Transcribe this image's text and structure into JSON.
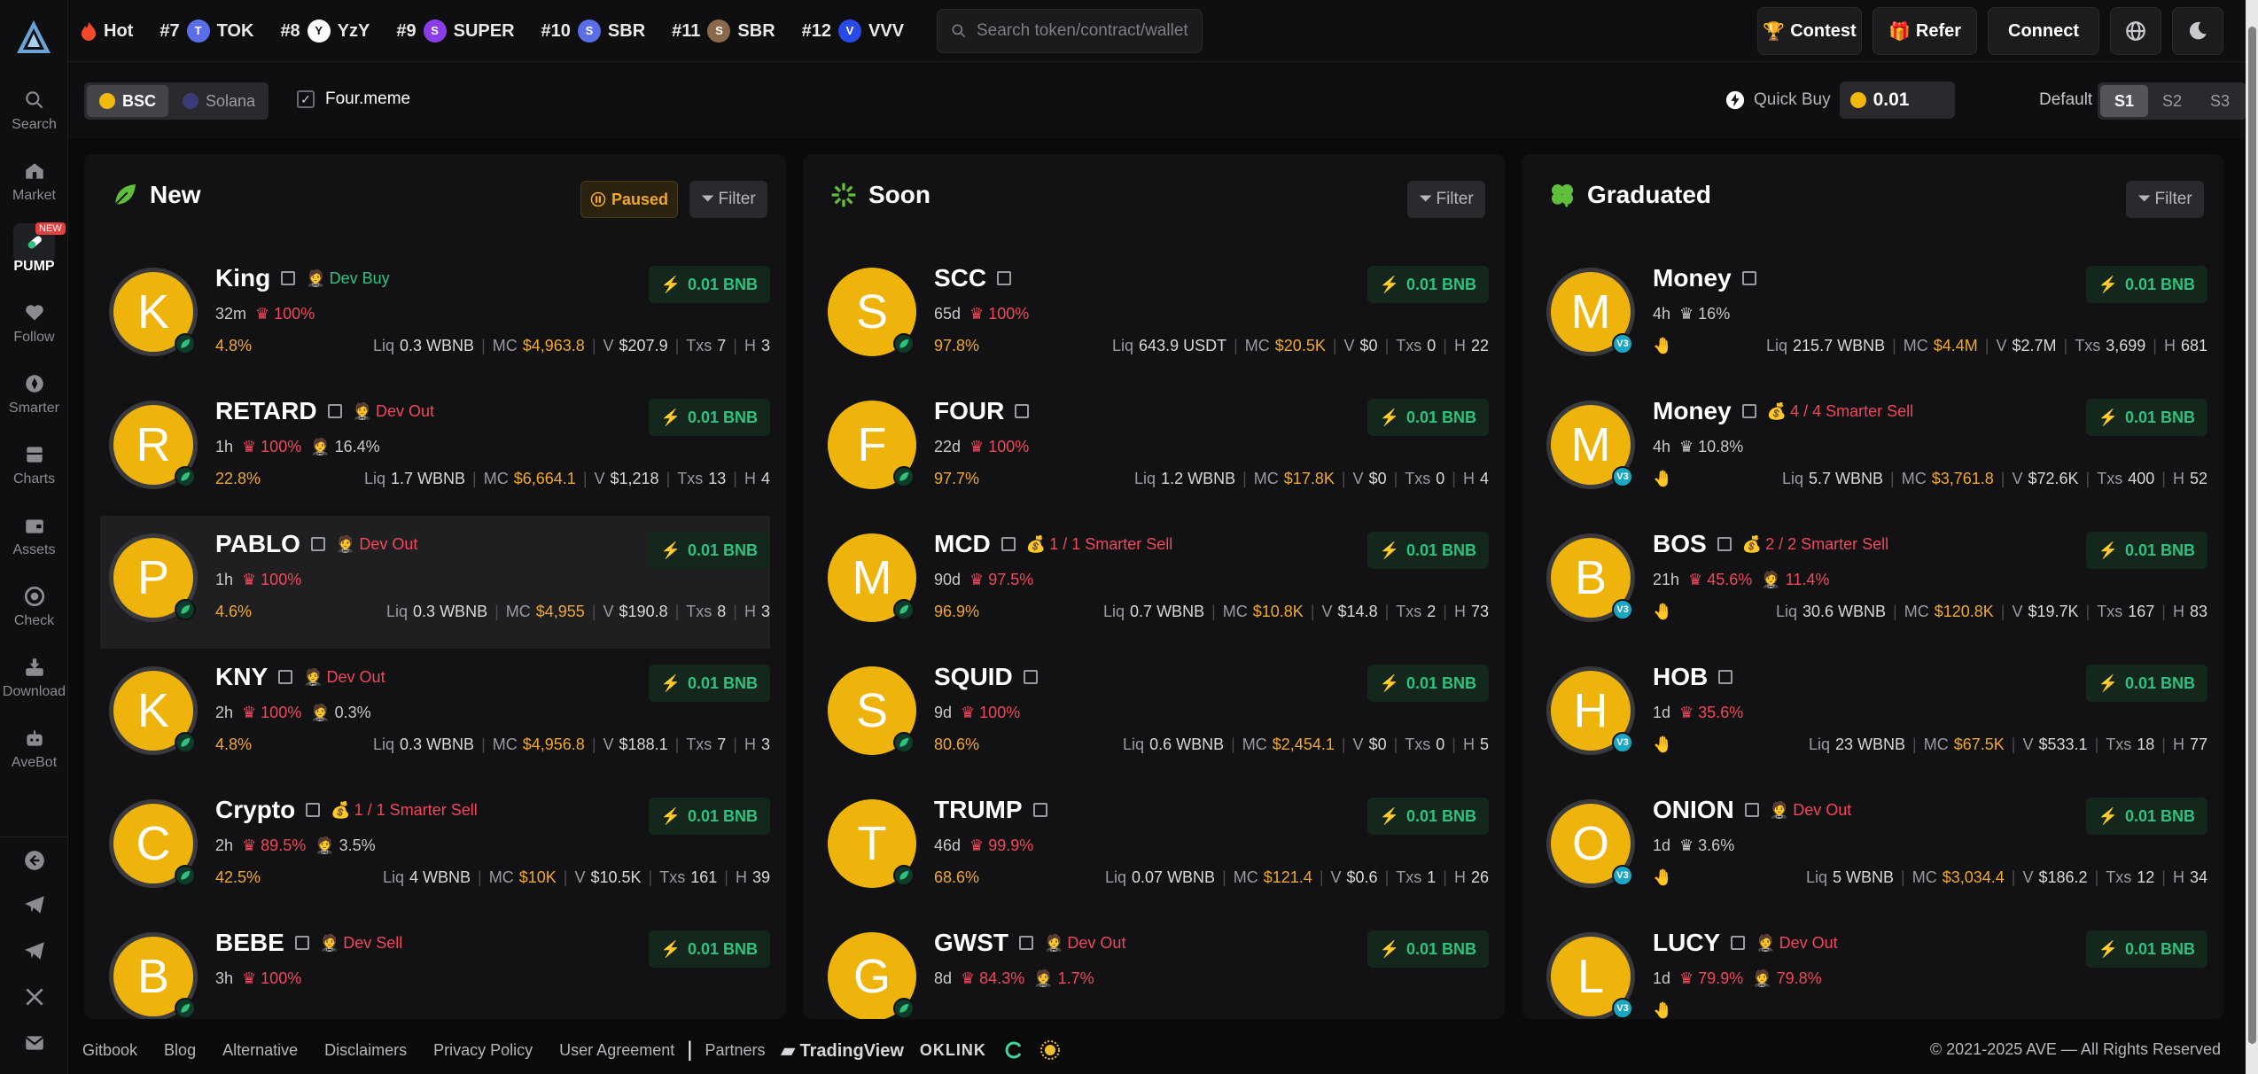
{
  "sidebar": {
    "items": [
      {
        "label": "Search",
        "icon": "search-icon"
      },
      {
        "label": "Market",
        "icon": "market-icon"
      },
      {
        "label": "PUMP",
        "icon": "pill-icon",
        "badge": "NEW"
      },
      {
        "label": "Follow",
        "icon": "heart-icon"
      },
      {
        "label": "Smarter",
        "icon": "compass-icon"
      },
      {
        "label": "Charts",
        "icon": "chart-icon"
      },
      {
        "label": "Assets",
        "icon": "wallet-icon"
      },
      {
        "label": "Check",
        "icon": "check-icon"
      },
      {
        "label": "Download",
        "icon": "download-icon"
      },
      {
        "label": "AveBot",
        "icon": "bot-icon"
      }
    ]
  },
  "ticker": {
    "hot": "Hot",
    "items": [
      {
        "rank": "#7",
        "symbol": "TOK",
        "color": "#5b6ee8",
        "letter": "T"
      },
      {
        "rank": "#8",
        "symbol": "YzY",
        "color": "#ffffff",
        "letter": "Y"
      },
      {
        "rank": "#9",
        "symbol": "SUPER",
        "color": "#8b3ee8",
        "letter": "S"
      },
      {
        "rank": "#10",
        "symbol": "SBR",
        "color": "#5b6ee8",
        "letter": "S"
      },
      {
        "rank": "#11",
        "symbol": "SBR",
        "color": "#8a6a4a",
        "letter": "S"
      },
      {
        "rank": "#12",
        "symbol": "VVV",
        "color": "#2a4ae8",
        "letter": "V"
      }
    ]
  },
  "search": {
    "placeholder": "Search token/contract/wallet"
  },
  "topbuttons": {
    "contest": "Contest",
    "refer": "Refer",
    "connect": "Connect"
  },
  "chains": {
    "bsc": "BSC",
    "solana": "Solana"
  },
  "fourmeme": "Four.meme",
  "quickbuy": {
    "label": "Quick Buy",
    "value": "0.01"
  },
  "defaultlabel": "Default",
  "presets": [
    "S1",
    "S2",
    "S3"
  ],
  "columns": {
    "new": {
      "title": "New",
      "paused": "Paused",
      "filter": "Filter"
    },
    "soon": {
      "title": "Soon",
      "filter": "Filter"
    },
    "graduated": {
      "title": "Graduated",
      "filter": "Filter"
    }
  },
  "buy_label": "0.01 BNB",
  "labels": {
    "liq": "Liq",
    "mc": "MC",
    "v": "V",
    "txs": "Txs",
    "h": "H"
  },
  "new_tokens": [
    {
      "letter": "K",
      "name": "King",
      "tag": "Dev Buy",
      "tagtype": "green",
      "age": "32m",
      "p1": "100%",
      "p2": "",
      "pct": "4.8%",
      "liq": "0.3 WBNB",
      "mc": "$4,963.8",
      "v": "$207.9",
      "txs": "7",
      "h": "3"
    },
    {
      "letter": "R",
      "name": "RETARD",
      "tag": "Dev Out",
      "tagtype": "red",
      "age": "1h",
      "p1": "100%",
      "p2": "16.4%",
      "pct": "22.8%",
      "liq": "1.7 WBNB",
      "mc": "$6,664.1",
      "v": "$1,218",
      "txs": "13",
      "h": "4"
    },
    {
      "letter": "P",
      "name": "PABLO",
      "tag": "Dev Out",
      "tagtype": "red",
      "age": "1h",
      "p1": "100%",
      "p2": "",
      "pct": "4.6%",
      "liq": "0.3 WBNB",
      "mc": "$4,955",
      "v": "$190.8",
      "txs": "8",
      "h": "3"
    },
    {
      "letter": "K",
      "name": "KNY",
      "tag": "Dev Out",
      "tagtype": "red",
      "age": "2h",
      "p1": "100%",
      "p2": "0.3%",
      "pct": "4.8%",
      "liq": "0.3 WBNB",
      "mc": "$4,956.8",
      "v": "$188.1",
      "txs": "7",
      "h": "3"
    },
    {
      "letter": "C",
      "name": "Crypto",
      "tag": "1 / 1 Smarter Sell",
      "tagtype": "red",
      "age": "2h",
      "p1": "89.5%",
      "p2": "3.5%",
      "pct": "42.5%",
      "liq": "4 WBNB",
      "mc": "$10K",
      "v": "$10.5K",
      "txs": "161",
      "h": "39"
    },
    {
      "letter": "B",
      "name": "BEBE",
      "tag": "Dev Sell",
      "tagtype": "red",
      "age": "3h",
      "p1": "100%",
      "p2": "",
      "pct": "",
      "liq": "",
      "mc": "",
      "v": "",
      "txs": "",
      "h": ""
    }
  ],
  "soon_tokens": [
    {
      "letter": "S",
      "name": "SCC",
      "tag": "",
      "age": "65d",
      "p1": "100%",
      "p2": "",
      "pct": "97.8%",
      "liq": "643.9 USDT",
      "mc": "$20.5K",
      "v": "$0",
      "txs": "0",
      "h": "22"
    },
    {
      "letter": "F",
      "name": "FOUR",
      "tag": "",
      "age": "22d",
      "p1": "100%",
      "p2": "",
      "pct": "97.7%",
      "liq": "1.2 WBNB",
      "mc": "$17.8K",
      "v": "$0",
      "txs": "0",
      "h": "4"
    },
    {
      "letter": "M",
      "name": "MCD",
      "tag": "1 / 1 Smarter Sell",
      "age": "90d",
      "p1": "97.5%",
      "p2": "",
      "pct": "96.9%",
      "liq": "0.7 WBNB",
      "mc": "$10.8K",
      "v": "$14.8",
      "txs": "2",
      "h": "73"
    },
    {
      "letter": "S",
      "name": "SQUID",
      "tag": "",
      "age": "9d",
      "p1": "100%",
      "p2": "",
      "pct": "80.6%",
      "liq": "0.6 WBNB",
      "mc": "$2,454.1",
      "v": "$0",
      "txs": "0",
      "h": "5"
    },
    {
      "letter": "T",
      "name": "TRUMP",
      "tag": "",
      "age": "46d",
      "p1": "99.9%",
      "p2": "",
      "pct": "68.6%",
      "liq": "0.07 WBNB",
      "mc": "$121.4",
      "v": "$0.6",
      "txs": "1",
      "h": "26"
    },
    {
      "letter": "G",
      "name": "GWST",
      "tag": "Dev Out",
      "age": "8d",
      "p1": "84.3%",
      "p2": "1.7%",
      "pct": "",
      "liq": "",
      "mc": "",
      "v": "",
      "txs": "",
      "h": ""
    }
  ],
  "grad_tokens": [
    {
      "letter": "M",
      "name": "Money",
      "tag": "",
      "age": "4h",
      "p1": "16%",
      "p2": "",
      "liq": "215.7 WBNB",
      "mc": "$4.4M",
      "v": "$2.7M",
      "txs": "3,699",
      "h": "681"
    },
    {
      "letter": "M",
      "name": "Money",
      "tag": "4 / 4 Smarter Sell",
      "age": "4h",
      "p1": "10.8%",
      "p2": "",
      "liq": "5.7 WBNB",
      "mc": "$3,761.8",
      "v": "$72.6K",
      "txs": "400",
      "h": "52"
    },
    {
      "letter": "B",
      "name": "BOS",
      "tag": "2 / 2 Smarter Sell",
      "age": "21h",
      "p1": "45.6%",
      "p2": "11.4%",
      "liq": "30.6 WBNB",
      "mc": "$120.8K",
      "v": "$19.7K",
      "txs": "167",
      "h": "83"
    },
    {
      "letter": "H",
      "name": "HOB",
      "tag": "",
      "age": "1d",
      "p1": "35.6%",
      "p2": "",
      "liq": "23 WBNB",
      "mc": "$67.5K",
      "v": "$533.1",
      "txs": "18",
      "h": "77"
    },
    {
      "letter": "O",
      "name": "ONION",
      "tag": "Dev Out",
      "age": "1d",
      "p1": "3.6%",
      "p2": "",
      "liq": "5 WBNB",
      "mc": "$3,034.4",
      "v": "$186.2",
      "txs": "12",
      "h": "34"
    },
    {
      "letter": "L",
      "name": "LUCY",
      "tag": "Dev Out",
      "age": "1d",
      "p1": "79.9%",
      "p2": "79.8%",
      "liq": "",
      "mc": "",
      "v": "",
      "txs": "",
      "h": ""
    }
  ],
  "footer": {
    "links": [
      "Gitbook",
      "Blog",
      "Alternative",
      "Disclaimers",
      "Privacy Policy",
      "User Agreement"
    ],
    "partners": "Partners",
    "tradingview": "TradingView",
    "oklink": "OKLINK",
    "copyright": "© 2021-2025 AVE — All Rights Reserved"
  },
  "colors": {
    "accent_green": "#2ec27e",
    "accent_red": "#f0475a",
    "accent_yellow": "#f0a82a",
    "avatar_yellow": "#eeb40c"
  }
}
